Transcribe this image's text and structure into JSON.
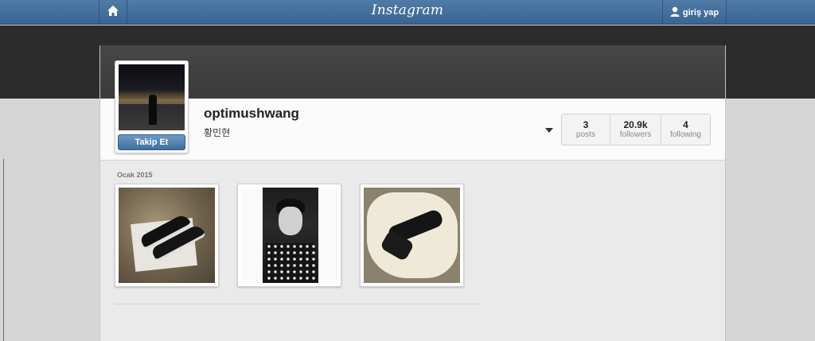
{
  "topbar": {
    "logo": "Instagram",
    "login_label": "giriş yap",
    "home_icon": "home-icon",
    "user_icon": "user-icon"
  },
  "profile": {
    "username": "optimushwang",
    "full_name": "황민현",
    "follow_label": "Takip Et"
  },
  "stats": [
    {
      "value": "3",
      "label": "posts"
    },
    {
      "value": "20.9k",
      "label": "followers"
    },
    {
      "value": "4",
      "label": "following"
    }
  ],
  "feed": {
    "month_label": "Ocak 2015"
  },
  "colors": {
    "topbar": "#3f6b99",
    "follow_button": "#4f7fae",
    "dark_band": "#2c2c2c"
  }
}
